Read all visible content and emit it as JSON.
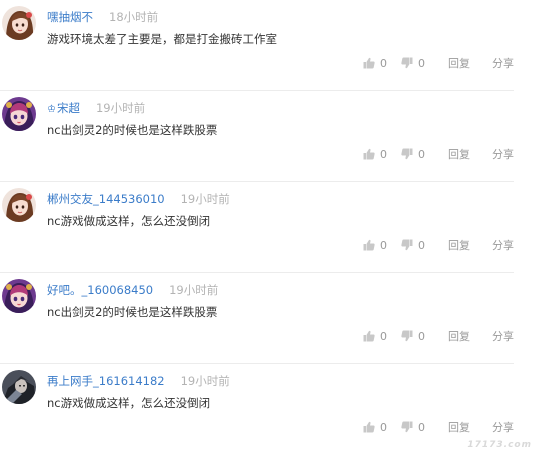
{
  "comments": [
    {
      "avatar": "avatar-girl-brown-hair",
      "vip_badge": "",
      "user": "嘿抽烟不",
      "time": "18小时前",
      "text": "游戏环境太差了主要是，都是打金搬砖工作室",
      "likes": "0",
      "dislikes": "0",
      "reply_label": "回复",
      "share_label": "分享"
    },
    {
      "avatar": "avatar-girl-purple",
      "vip_badge": "♔",
      "user": "宋超",
      "time": "19小时前",
      "text": "nc出剑灵2的时候也是这样跌股票",
      "likes": "0",
      "dislikes": "0",
      "reply_label": "回复",
      "share_label": "分享"
    },
    {
      "avatar": "avatar-girl-brown-hair",
      "vip_badge": "",
      "user": "郴州交友_144536010",
      "time": "19小时前",
      "text": "nc游戏做成这样，怎么还没倒闭",
      "likes": "0",
      "dislikes": "0",
      "reply_label": "回复",
      "share_label": "分享"
    },
    {
      "avatar": "avatar-girl-purple",
      "vip_badge": "",
      "user": "好吧。_160068450",
      "time": "19小时前",
      "text": "nc出剑灵2的时候也是这样跌股票",
      "likes": "0",
      "dislikes": "0",
      "reply_label": "回复",
      "share_label": "分享"
    },
    {
      "avatar": "avatar-dark-warrior",
      "vip_badge": "",
      "user": "再上网手_161614182",
      "time": "19小时前",
      "text": "nc游戏做成这样，怎么还没倒闭",
      "likes": "0",
      "dislikes": "0",
      "reply_label": "回复",
      "share_label": "分享"
    }
  ],
  "watermark": "17173.com",
  "colors": {
    "username": "#3b7cc9",
    "time": "#b3b3b3",
    "action": "#9a9a9a",
    "divider": "#ececec"
  }
}
